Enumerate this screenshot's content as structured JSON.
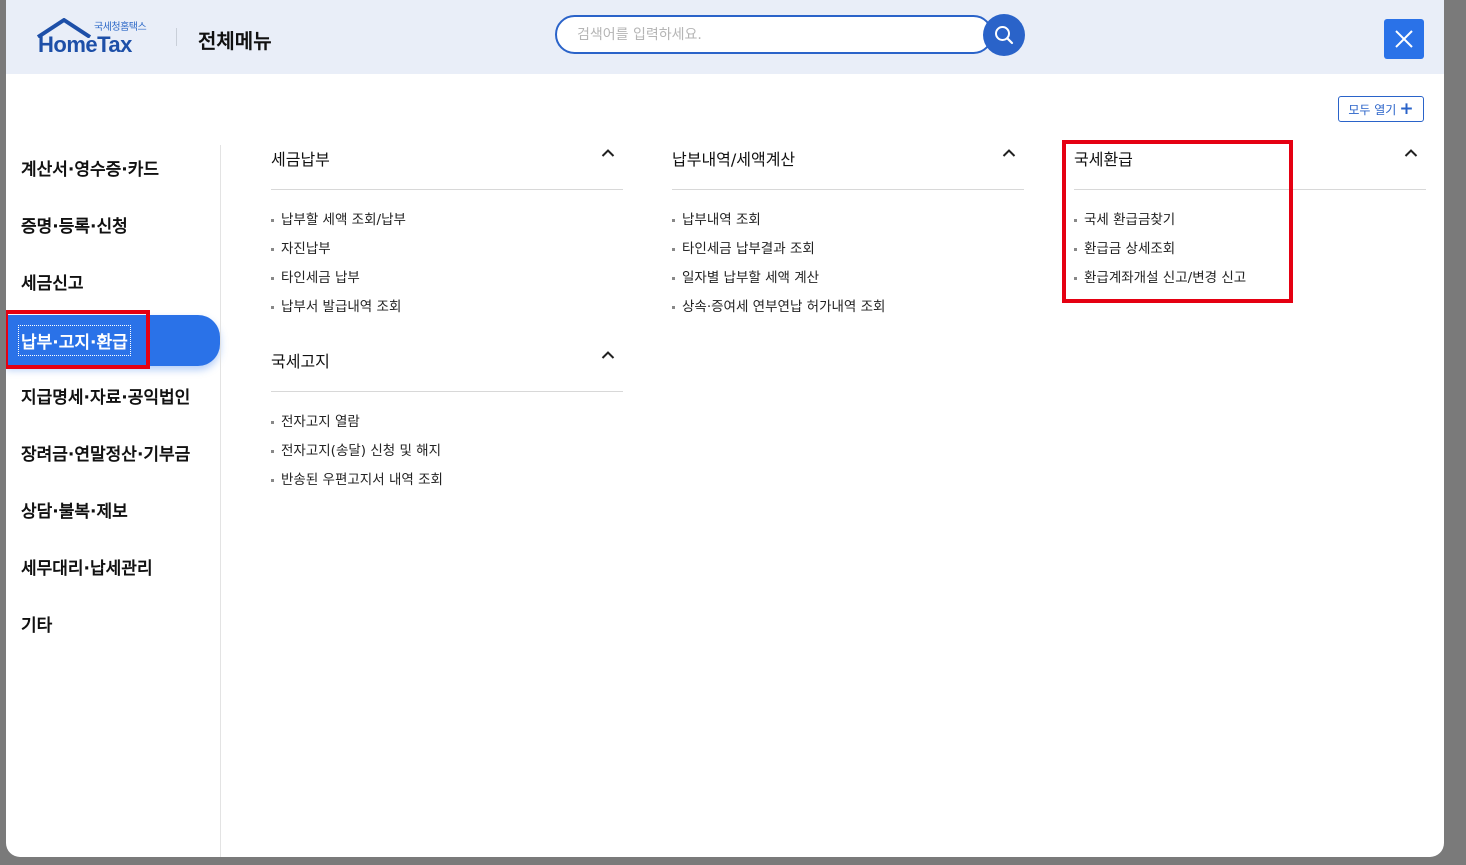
{
  "header": {
    "logo_sub": "국세청홈택스",
    "logo_main": "HomeTax",
    "title": "전체메뉴",
    "search_placeholder": "검색어를 입력하세요.",
    "search_icon": "search-icon",
    "close_icon": "close-icon"
  },
  "toolbar": {
    "expand_all_label": "모두 열기",
    "expand_icon": "plus-icon"
  },
  "sidebar": {
    "items": [
      {
        "label": "계산서·영수증·카드"
      },
      {
        "label": "증명·등록·신청"
      },
      {
        "label": "세금신고"
      },
      {
        "label": "납부·고지·환급"
      },
      {
        "label": "지급명세·자료·공익법인"
      },
      {
        "label": "장려금·연말정산·기부금"
      },
      {
        "label": "상담·불복·제보"
      },
      {
        "label": "세무대리·납세관리"
      },
      {
        "label": "기타"
      }
    ],
    "active_index": 3
  },
  "sections": [
    {
      "title": "세금납부",
      "links": [
        "납부할 세액 조회/납부",
        "자진납부",
        "타인세금 납부",
        "납부서 발급내역 조회"
      ]
    },
    {
      "title": "국세고지",
      "links": [
        "전자고지 열람",
        "전자고지(송달) 신청 및 해지",
        "반송된 우편고지서 내역 조회"
      ]
    },
    {
      "title": "납부내역/세액계산",
      "links": [
        "납부내역 조회",
        "타인세금 납부결과 조회",
        "일자별 납부할 세액 계산",
        "상속·증여세 연부연납 허가내역 조회"
      ]
    },
    {
      "title": "국세환급",
      "links": [
        "국세 환급금찾기",
        "환급금 상세조회",
        "환급계좌개설 신고/변경 신고"
      ]
    }
  ],
  "colors": {
    "accent": "#2a72e8",
    "header_bg": "#e9eef8",
    "highlight": "#e50012"
  }
}
